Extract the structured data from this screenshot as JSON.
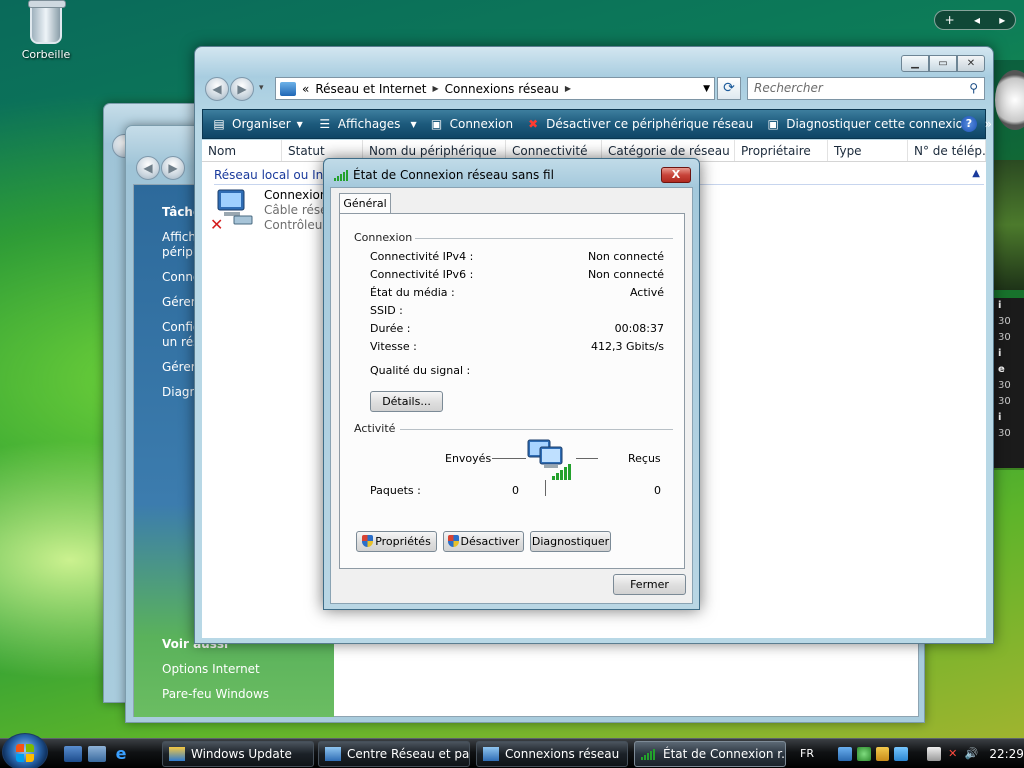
{
  "desktop": {
    "recycle_bin_label": "Corbeille",
    "gadget_feed_numbers": [
      "30",
      "30",
      "30",
      "30",
      "30"
    ]
  },
  "back_window": {
    "sidebar_title": "Tâche",
    "tasks": [
      "Affich",
      "périph",
      "Conne",
      "Gérer l",
      "Config",
      "un rés",
      "Gérer l",
      "Diagn"
    ],
    "see_also_title": "Voir aussi",
    "see_also_links": [
      "Options Internet",
      "Pare-feu Windows"
    ]
  },
  "main_window": {
    "address": {
      "chevrons": "«",
      "crumbs": [
        "Réseau et Internet",
        "Connexions réseau"
      ]
    },
    "search_placeholder": "Rechercher",
    "toolbar": [
      {
        "label": "Organiser",
        "icon": "organize-icon",
        "dropdown": true
      },
      {
        "label": "Affichages",
        "icon": "views-icon",
        "dropdown": true
      },
      {
        "label": "Connexion",
        "icon": "connect-icon",
        "dropdown": false
      },
      {
        "label": "Désactiver ce périphérique réseau",
        "icon": "disable-icon",
        "dropdown": false
      },
      {
        "label": "Diagnostiquer cette connexion",
        "icon": "diagnose-icon",
        "dropdown": false
      }
    ],
    "toolbar_more": "»",
    "columns": [
      "Nom",
      "Statut",
      "Nom du périphérique",
      "Connectivité",
      "Catégorie de réseau",
      "Propriétaire",
      "Type",
      "N° de télép..."
    ],
    "group_header": "Réseau local ou Inter",
    "item": {
      "line1": "Connexion",
      "line2": "Câble résea",
      "line3": "Contrôleur"
    }
  },
  "dialog": {
    "title": "État de Connexion réseau sans fil",
    "close_label": "X",
    "tab": "Général",
    "connection_section": "Connexion",
    "rows": [
      {
        "label": "Connectivité IPv4 :",
        "value": "Non connecté"
      },
      {
        "label": "Connectivité IPv6 :",
        "value": "Non connecté"
      },
      {
        "label": "État du média :",
        "value": "Activé"
      },
      {
        "label": "SSID :",
        "value": ""
      },
      {
        "label": "Durée :",
        "value": "00:08:37"
      },
      {
        "label": "Vitesse :",
        "value": "412,3 Gbits/s"
      }
    ],
    "signal_label": "Qualité du signal :",
    "details_button": "Détails...",
    "activity_section": "Activité",
    "sent_label": "Envoyés",
    "received_label": "Reçus",
    "packets_label": "Paquets :",
    "packets_sent": "0",
    "packets_received": "0",
    "properties_button": "Propriétés",
    "disable_button": "Désactiver",
    "diagnose_button": "Diagnostiquer",
    "close_button": "Fermer"
  },
  "taskbar": {
    "tasks": [
      {
        "label": "Windows Update",
        "active": false
      },
      {
        "label": "Centre Réseau et pa...",
        "active": false
      },
      {
        "label": "Connexions réseau",
        "active": false
      },
      {
        "label": "État de Connexion r...",
        "active": true
      }
    ],
    "language": "FR",
    "time": "22:29"
  },
  "colors": {
    "accent": "#1d5a7c",
    "link": "#1a3a9c",
    "signal": "#23a12c"
  }
}
